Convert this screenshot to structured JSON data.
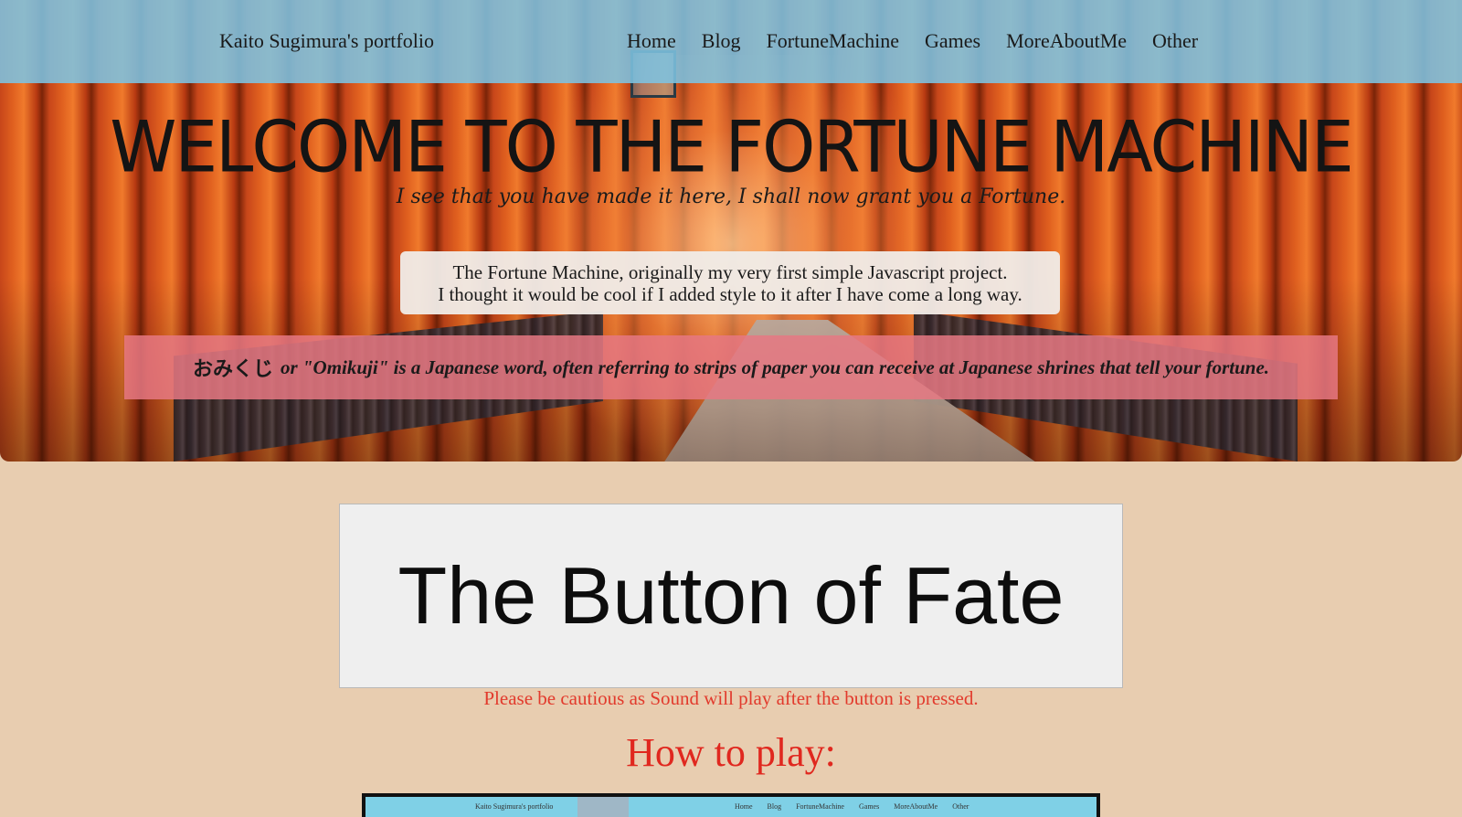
{
  "navbar": {
    "brand": "Kaito Sugimura's portfolio",
    "links": [
      "Home",
      "Blog",
      "FortuneMachine",
      "Games",
      "MoreAboutMe",
      "Other"
    ]
  },
  "hero": {
    "title": "WELCOME TO THE FORTUNE MACHINE",
    "subtitle": "I see that you have made it here, I shall now grant you a Fortune.",
    "intro_line1": "The Fortune Machine, originally my very first simple Javascript project.",
    "intro_line2": "I thought it would be cool if I added style to it after I have come a long way.",
    "omikuji_jp": "おみくじ",
    "omikuji_text": "or \"Omikuji\" is a Japanese word, often referring to strips of paper you can receive at Japanese shrines that tell your fortune."
  },
  "main": {
    "fate_button_label": "The Button of Fate",
    "caution": "Please be cautious as Sound will play after the button is pressed.",
    "howto_heading": "How to play:",
    "preview_brand": "Kaito Sugimura's portfolio",
    "preview_nav": "Home Blog FortuneMachine Games MoreAboutMe Other"
  },
  "colors": {
    "navbar_bg": "#7dc3e1",
    "page_bg": "#e8cdb0",
    "caution_red": "#e23a2c",
    "howto_red": "#e0281f",
    "omikuji_bg": "#e67882"
  }
}
